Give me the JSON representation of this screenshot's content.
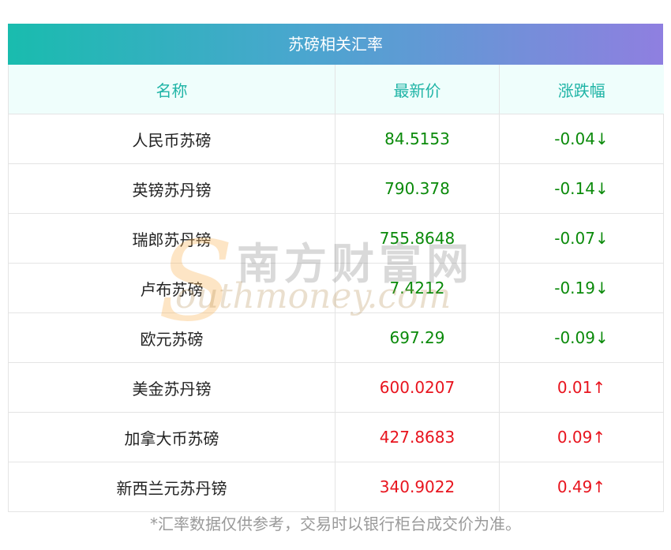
{
  "header": {
    "title": "苏磅相关汇率"
  },
  "table": {
    "columns": [
      "名称",
      "最新价",
      "涨跌幅"
    ],
    "rows": [
      {
        "name": "人民币苏磅",
        "price": "84.5153",
        "change": "-0.04↓",
        "trend": "down"
      },
      {
        "name": "英镑苏丹镑",
        "price": "790.378",
        "change": "-0.14↓",
        "trend": "down"
      },
      {
        "name": "瑞郎苏丹镑",
        "price": "755.8648",
        "change": "-0.07↓",
        "trend": "down"
      },
      {
        "name": "卢布苏磅",
        "price": "7.4212",
        "change": "-0.19↓",
        "trend": "down"
      },
      {
        "name": "欧元苏磅",
        "price": "697.29",
        "change": "-0.09↓",
        "trend": "down"
      },
      {
        "name": "美金苏丹镑",
        "price": "600.0207",
        "change": "0.01↑",
        "trend": "up"
      },
      {
        "name": "加拿大币苏磅",
        "price": "427.8683",
        "change": "0.09↑",
        "trend": "up"
      },
      {
        "name": "新西兰元苏丹镑",
        "price": "340.9022",
        "change": "0.49↑",
        "trend": "up"
      }
    ]
  },
  "watermark": {
    "cn": "南方财富网",
    "en": "outhmoney.com",
    "initial": "S"
  },
  "footnote": "*汇率数据仅供参考，交易时以银行柜台成交价为准。",
  "colors": {
    "down": "#0a8a0a",
    "up": "#e8141e",
    "header_text": "#1fb4a6"
  }
}
